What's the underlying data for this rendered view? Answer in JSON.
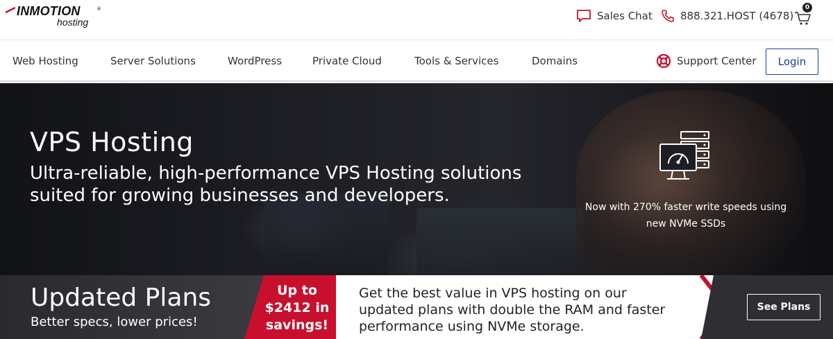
{
  "logo": {
    "brand": "INMOTION",
    "sub": "hosting",
    "reg": "®"
  },
  "utility": {
    "sales_chat": "Sales Chat",
    "phone": "888.321.HOST (4678)",
    "cart_count": "0"
  },
  "nav": {
    "items": [
      "Web Hosting",
      "Server Solutions",
      "WordPress",
      "Private Cloud",
      "Tools & Services",
      "Domains"
    ],
    "support_label": "Support Center",
    "login_label": "Login"
  },
  "hero": {
    "title": "VPS Hosting",
    "subtitle": "Ultra-reliable, high-performance VPS Hosting solutions suited for growing businesses and developers.",
    "perf_text": "Now with 270% faster write speeds using new NVMe SSDs"
  },
  "promo": {
    "title": "Updated Plans",
    "tagline": "Better specs, lower prices!",
    "savings": "Up to $2412 in savings!",
    "description": "Get the best value in VPS hosting on our updated plans with double the RAM and faster performance using NVMe storage.",
    "cta_label": "See Plans"
  },
  "colors": {
    "accent_red": "#c8102e",
    "login_blue": "#1b3f8f"
  },
  "icons": [
    "chat-icon",
    "phone-icon",
    "cart-icon",
    "lifebuoy-icon",
    "server-gauge-icon"
  ]
}
